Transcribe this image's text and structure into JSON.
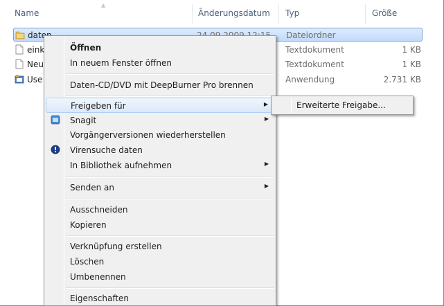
{
  "columns": {
    "name": "Name",
    "date": "Änderungsdatum",
    "type": "Typ",
    "size": "Größe"
  },
  "files": [
    {
      "name": "daten",
      "date": "24.09.2009 12:15",
      "type": "Dateiordner",
      "size": "",
      "icon": "folder-icon",
      "selected": true
    },
    {
      "name": "eink",
      "date": "",
      "type": "Textdokument",
      "size": "1 KB",
      "icon": "text-document-icon",
      "selected": false
    },
    {
      "name": "Neu",
      "date": "",
      "type": "Textdokument",
      "size": "1 KB",
      "icon": "text-document-icon",
      "selected": false
    },
    {
      "name": "Use",
      "date": "",
      "type": "Anwendung",
      "size": "2.731 KB",
      "icon": "application-icon",
      "selected": false
    }
  ],
  "context_menu": {
    "open": "Öffnen",
    "open_new_window": "In neuem Fenster öffnen",
    "burn": "Daten-CD/DVD mit DeepBurner Pro brennen",
    "share_with": "Freigeben für",
    "snagit": "Snagit",
    "restore_versions": "Vorgängerversionen wiederherstellen",
    "virus_scan": "Virensuche daten",
    "add_to_library": "In Bibliothek aufnehmen",
    "send_to": "Senden an",
    "cut": "Ausschneiden",
    "copy": "Kopieren",
    "create_shortcut": "Verknüpfung erstellen",
    "delete": "Löschen",
    "rename": "Umbenennen",
    "properties": "Eigenschaften"
  },
  "submenu": {
    "advanced_sharing": "Erweiterte Freigabe..."
  },
  "colors": {
    "header_text": "#4c607a",
    "selection_border": "#7da2ce",
    "menu_bg": "#f0f0f0",
    "hover_border": "#aecff7"
  }
}
